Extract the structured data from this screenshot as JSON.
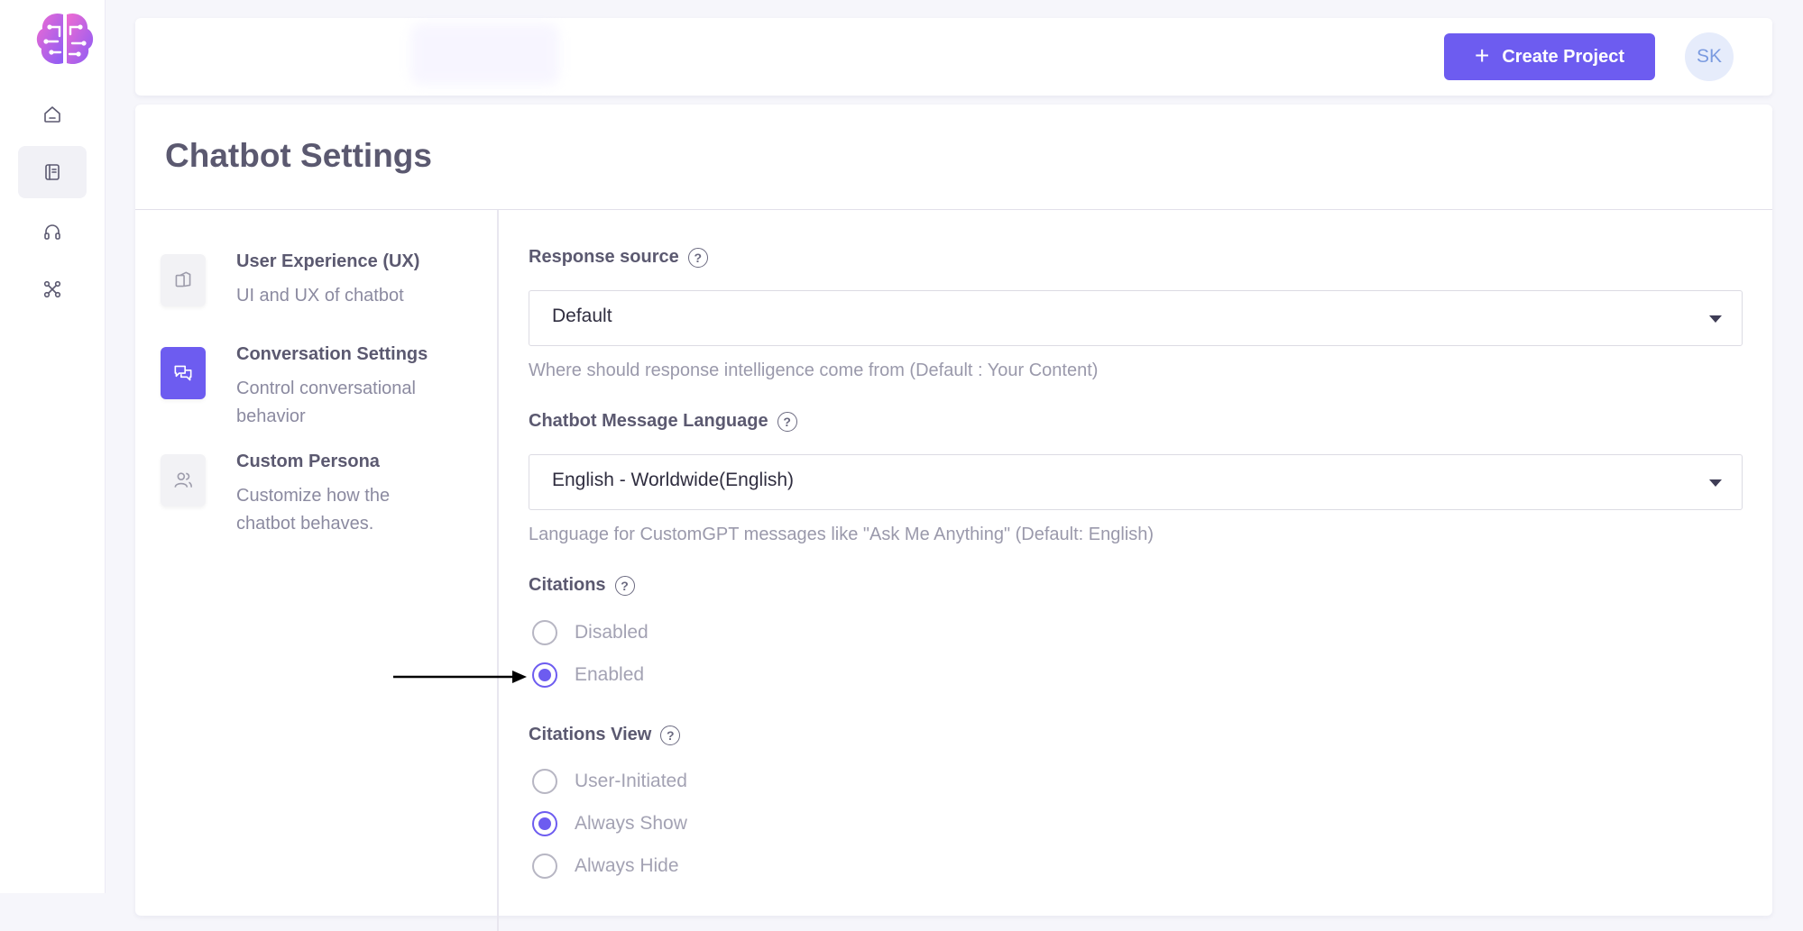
{
  "header": {
    "create_button_label": "Create Project",
    "avatar_initials": "SK"
  },
  "page": {
    "title": "Chatbot Settings"
  },
  "settings_nav": [
    {
      "title": "User Experience (UX)",
      "description": "UI and UX of chatbot",
      "icon": "layout-icon",
      "active": false
    },
    {
      "title": "Conversation Settings",
      "description": "Control conversational behavior",
      "icon": "chat-icon",
      "active": true
    },
    {
      "title": "Custom Persona",
      "description": "Customize how the chatbot behaves.",
      "icon": "users-icon",
      "active": false
    }
  ],
  "response_source": {
    "label": "Response source",
    "value": "Default",
    "hint": "Where should response intelligence come from (Default : Your Content)"
  },
  "language": {
    "label": "Chatbot Message Language",
    "value": "English - Worldwide(English)",
    "hint": "Language for CustomGPT messages like \"Ask Me Anything\" (Default: English)"
  },
  "citations": {
    "label": "Citations",
    "options": [
      "Disabled",
      "Enabled"
    ],
    "selected": "Enabled"
  },
  "citations_view": {
    "label": "Citations View",
    "options": [
      "User-Initiated",
      "Always Show",
      "Always Hide"
    ],
    "selected": "Always Show"
  },
  "colors": {
    "accent": "#6d5cf0",
    "text_dark": "#5b5970",
    "text_muted": "#9a99ab"
  }
}
